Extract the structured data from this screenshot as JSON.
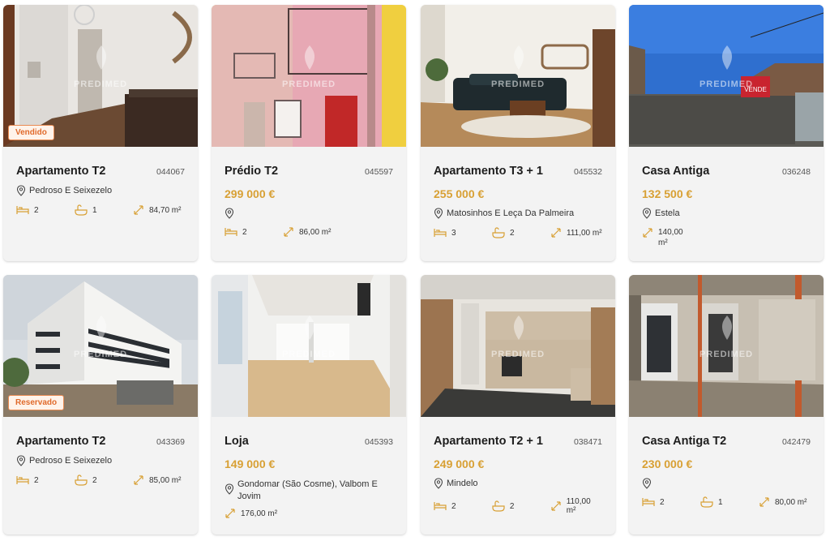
{
  "watermark": "PREDIMED",
  "colors": {
    "accent": "#d8a034",
    "tag_text": "#e06a2b",
    "card_bg": "#f3f3f3"
  },
  "listings": [
    {
      "title": "Apartamento T2",
      "ref": "044067",
      "price": "",
      "location": "Pedroso E Seixezelo",
      "beds": "2",
      "baths": "1",
      "area": "84,70 m²",
      "tag": "Vendido"
    },
    {
      "title": "Prédio T2",
      "ref": "045597",
      "price": "299 000 €",
      "location": "",
      "beds": "2",
      "baths": "",
      "area": "86,00 m²",
      "tag": ""
    },
    {
      "title": "Apartamento T3 + 1",
      "ref": "045532",
      "price": "255 000 €",
      "location": "Matosinhos E Leça Da Palmeira",
      "beds": "3",
      "baths": "2",
      "area": "111,00 m²",
      "tag": ""
    },
    {
      "title": "Casa Antiga",
      "ref": "036248",
      "price": "132 500 €",
      "location": "Estela",
      "beds": "",
      "baths": "",
      "area": "140,00 m²",
      "tag": "",
      "sign": "VENDE"
    },
    {
      "title": "Apartamento T2",
      "ref": "043369",
      "price": "",
      "location": "Pedroso E Seixezelo",
      "beds": "2",
      "baths": "2",
      "area": "85,00 m²",
      "tag": "Reservado"
    },
    {
      "title": "Loja",
      "ref": "045393",
      "price": "149 000 €",
      "location": "Gondomar (São Cosme), Valbom E Jovim",
      "beds": "",
      "baths": "",
      "area": "176,00 m²",
      "tag": ""
    },
    {
      "title": "Apartamento T2 + 1",
      "ref": "038471",
      "price": "249 000 €",
      "location": "Mindelo",
      "beds": "2",
      "baths": "2",
      "area": "110,00 m²",
      "tag": ""
    },
    {
      "title": "Casa Antiga T2",
      "ref": "042479",
      "price": "230 000 €",
      "location": "",
      "beds": "2",
      "baths": "1",
      "area": "80,00 m²",
      "tag": ""
    }
  ]
}
